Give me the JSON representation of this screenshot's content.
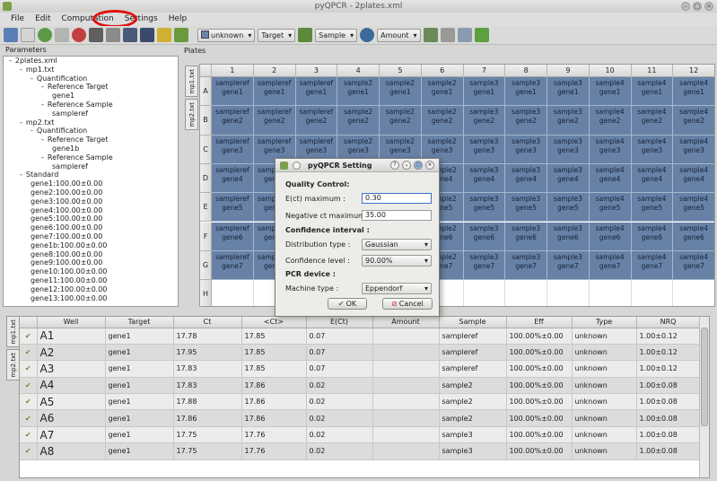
{
  "window": {
    "title": "pyQPCR - 2plates.xml"
  },
  "menu": {
    "items": [
      "File",
      "Edit",
      "Computation",
      "Settings",
      "Help"
    ]
  },
  "toolbar": {
    "color_combo": "unknown",
    "target_combo": "Target",
    "sample_combo": "Sample",
    "amount_combo": "Amount"
  },
  "params": {
    "title": "Parameters",
    "tree": [
      {
        "level": 0,
        "prefix": "-",
        "text": "2plates.xml"
      },
      {
        "level": 1,
        "prefix": "-",
        "text": "mp1.txt"
      },
      {
        "level": 2,
        "prefix": "-",
        "text": "Quantification"
      },
      {
        "level": 3,
        "prefix": "-",
        "text": "Reference Target"
      },
      {
        "level": 4,
        "prefix": "",
        "text": "gene1"
      },
      {
        "level": 3,
        "prefix": "-",
        "text": "Reference Sample"
      },
      {
        "level": 4,
        "prefix": "",
        "text": "sampleref"
      },
      {
        "level": 1,
        "prefix": "-",
        "text": "mp2.txt"
      },
      {
        "level": 2,
        "prefix": "-",
        "text": "Quantification"
      },
      {
        "level": 3,
        "prefix": "-",
        "text": "Reference Target"
      },
      {
        "level": 4,
        "prefix": "",
        "text": "gene1b"
      },
      {
        "level": 3,
        "prefix": "-",
        "text": "Reference Sample"
      },
      {
        "level": 4,
        "prefix": "",
        "text": "sampleref"
      },
      {
        "level": 1,
        "prefix": "-",
        "text": "Standard"
      },
      {
        "level": 2,
        "prefix": "",
        "text": "gene1:100.00±0.00"
      },
      {
        "level": 2,
        "prefix": "",
        "text": "gene2:100.00±0.00"
      },
      {
        "level": 2,
        "prefix": "",
        "text": "gene3:100.00±0.00"
      },
      {
        "level": 2,
        "prefix": "",
        "text": "gene4:100.00±0.00"
      },
      {
        "level": 2,
        "prefix": "",
        "text": "gene5:100.00±0.00"
      },
      {
        "level": 2,
        "prefix": "",
        "text": "gene6:100.00±0.00"
      },
      {
        "level": 2,
        "prefix": "",
        "text": "gene7:100.00±0.00"
      },
      {
        "level": 2,
        "prefix": "",
        "text": "gene1b:100.00±0.00"
      },
      {
        "level": 2,
        "prefix": "",
        "text": "gene8:100.00±0.00"
      },
      {
        "level": 2,
        "prefix": "",
        "text": "gene9:100.00±0.00"
      },
      {
        "level": 2,
        "prefix": "",
        "text": "gene10:100.00±0.00"
      },
      {
        "level": 2,
        "prefix": "",
        "text": "gene11:100.00±0.00"
      },
      {
        "level": 2,
        "prefix": "",
        "text": "gene12:100.00±0.00"
      },
      {
        "level": 2,
        "prefix": "",
        "text": "gene13:100.00±0.00"
      }
    ]
  },
  "plates": {
    "title": "Plates",
    "tabs": [
      "mp1.txt",
      "mp2.txt"
    ],
    "columns": [
      "1",
      "2",
      "3",
      "4",
      "5",
      "6",
      "7",
      "8",
      "9",
      "10",
      "11",
      "12"
    ],
    "rows": [
      "A",
      "B",
      "C",
      "D",
      "E",
      "F",
      "G",
      "H"
    ],
    "col_samples": [
      "sampleref",
      "sampleref",
      "sampleref",
      "sample2",
      "sample2",
      "sample2",
      "sample3",
      "sample3",
      "sample3",
      "sample4",
      "sample4",
      "sample4"
    ],
    "row_genes": [
      "gene1",
      "gene2",
      "gene3",
      "gene4",
      "gene5",
      "gene6",
      "gene7",
      ""
    ]
  },
  "table": {
    "tabs": [
      "mp1.txt",
      "mp2.txt"
    ],
    "headers": [
      "",
      "Well",
      "Target",
      "Ct",
      "<Ct>",
      "E(Ct)",
      "Amount",
      "Sample",
      "Eff",
      "Type",
      "NRQ"
    ],
    "rows": [
      [
        "✔",
        "A1",
        "gene1",
        "17.78",
        "17.85",
        "0.07",
        "",
        "sampleref",
        "100.00%±0.00",
        "unknown",
        "1.00±0.12"
      ],
      [
        "✔",
        "A2",
        "gene1",
        "17.95",
        "17.85",
        "0.07",
        "",
        "sampleref",
        "100.00%±0.00",
        "unknown",
        "1.00±0.12"
      ],
      [
        "✔",
        "A3",
        "gene1",
        "17.83",
        "17.85",
        "0.07",
        "",
        "sampleref",
        "100.00%±0.00",
        "unknown",
        "1.00±0.12"
      ],
      [
        "✔",
        "A4",
        "gene1",
        "17.83",
        "17.86",
        "0.02",
        "",
        "sample2",
        "100.00%±0.00",
        "unknown",
        "1.00±0.08"
      ],
      [
        "✔",
        "A5",
        "gene1",
        "17.88",
        "17.86",
        "0.02",
        "",
        "sample2",
        "100.00%±0.00",
        "unknown",
        "1.00±0.08"
      ],
      [
        "✔",
        "A6",
        "gene1",
        "17.86",
        "17.86",
        "0.02",
        "",
        "sample2",
        "100.00%±0.00",
        "unknown",
        "1.00±0.08"
      ],
      [
        "✔",
        "A7",
        "gene1",
        "17.75",
        "17.76",
        "0.02",
        "",
        "sample3",
        "100.00%±0.00",
        "unknown",
        "1.00±0.08"
      ],
      [
        "✔",
        "A8",
        "gene1",
        "17.75",
        "17.76",
        "0.02",
        "",
        "sample3",
        "100.00%±0.00",
        "unknown",
        "1.00±0.08"
      ]
    ]
  },
  "dialog": {
    "title": "pyQPCR Setting",
    "qc_section": "Quality Control:",
    "ect_label": "E(ct) maximum :",
    "ect_value": "0.30",
    "neg_label": "Negative ct maximum :",
    "neg_value": "35.00",
    "ci_section": "Confidence interval :",
    "dist_label": "Distribution type :",
    "dist_value": "Gaussian",
    "conf_label": "Confidence level :",
    "conf_value": "90.00%",
    "pcr_section": "PCR device :",
    "machine_label": "Machine type :",
    "machine_value": "Eppendorf",
    "ok_label": "OK",
    "cancel_label": "Cancel"
  },
  "colors": {
    "well": "#6782a6",
    "highlight": "#e01010"
  }
}
